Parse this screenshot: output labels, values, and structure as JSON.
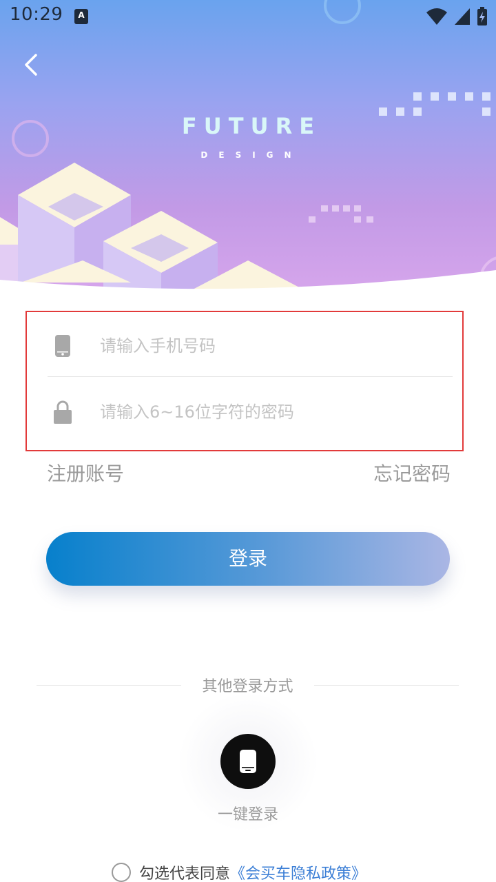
{
  "status_bar": {
    "time": "10:29",
    "notification_icon": "A",
    "icons": [
      "wifi-icon",
      "signal-icon",
      "battery-charging-icon"
    ]
  },
  "header": {
    "logo_title": "FUTURE",
    "logo_subtitle": "DESIGN"
  },
  "form": {
    "phone_placeholder": "请输入手机号码",
    "password_placeholder": "请输入6~16位字符的密码",
    "phone_icon": "phone-icon",
    "password_icon": "lock-icon"
  },
  "links": {
    "register": "注册账号",
    "forgot": "忘记密码"
  },
  "login_button": "登录",
  "other_login": {
    "label": "其他登录方式",
    "onekey_label": "一键登录",
    "onekey_icon": "phone-icon"
  },
  "agreement": {
    "text": "勾选代表同意",
    "link": "《会买车隐私政策》"
  },
  "colors": {
    "accent": "#0780cc",
    "link": "#3c7fd6",
    "error_border": "#e23a3a"
  }
}
